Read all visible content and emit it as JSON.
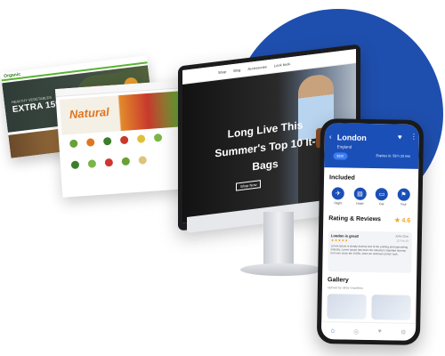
{
  "grocery_card": {
    "logo": "Organic",
    "small_caption": "HEALTHY VEGETABLES",
    "promo": "EXTRA 15% OFF"
  },
  "natural_card": {
    "brand": "Natural"
  },
  "monitor": {
    "nav_items": [
      "Shop",
      "Blog",
      "Accessories",
      "Look book"
    ],
    "headline": "Long Live This Summer's Top 10 It-Bags",
    "cta": "Shop Now"
  },
  "phone": {
    "city": "London",
    "country": "England",
    "tag": "$320",
    "expires": "Expires in: 58 h 23 min",
    "included_title": "Included",
    "included_items": [
      {
        "icon": "plane-icon",
        "glyph": "✈",
        "label": "Flight"
      },
      {
        "icon": "hotel-icon",
        "glyph": "▤",
        "label": "Hotel"
      },
      {
        "icon": "car-icon",
        "glyph": "▭",
        "label": "Car"
      },
      {
        "icon": "tour-icon",
        "glyph": "⚑",
        "label": "Tour"
      }
    ],
    "rating_title": "Rating & Reviews",
    "rating_value": "★ 4.6",
    "review": {
      "title": "London is great!",
      "author": "John Doe",
      "date": "12 Feb 19",
      "stars": "★★★★★",
      "body": "Lorem Ipsum is simply dummy text of the printing and typesetting industry. Lorem Ipsum has been the industry's standard dummy text ever since the 1500s, when an unknown printer took."
    },
    "gallery_title": "Gallery",
    "gallery_subtitle": "Upload by other travellers",
    "colors": {
      "primary": "#1b4fb8",
      "rating": "#f2a21a"
    }
  }
}
